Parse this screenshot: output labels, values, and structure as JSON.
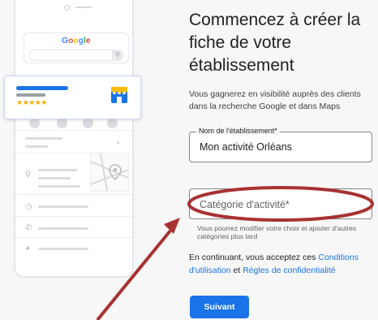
{
  "illustration": {
    "google_logo": [
      "G",
      "o",
      "o",
      "g",
      "l",
      "e"
    ],
    "google_colors": [
      "#4285F4",
      "#EA4335",
      "#FBBC05",
      "#4285F4",
      "#34A853",
      "#EA4335"
    ],
    "stars": "★★★★★",
    "icons": [
      "phone-icon",
      "globe-icon",
      "pin-icon",
      "clock-icon",
      "store-icon",
      "search-icon"
    ]
  },
  "form": {
    "title": "Commencez à créer la fiche de votre établissement",
    "subtitle": "Vous gagnerez en visibilité auprès des clients dans la recherche Google et dans Maps",
    "business_name_label": "Nom de l'établissement*",
    "business_name_value": "Mon activité Orléans",
    "category_placeholder": "Catégorie d'activité*",
    "category_hint": "Vous pourrez modifier votre choix et ajouter d'autres catégories plus tard",
    "terms_prefix": "En continuant, vous acceptez ces ",
    "terms_link1": "Conditions d'utilisation",
    "terms_middle": " et ",
    "terms_link2": "Règles de confidentialité",
    "next_button": "Suivant"
  },
  "colors": {
    "accent": "#1a73e8",
    "annotation": "#a83232",
    "star": "#f9ab00"
  }
}
